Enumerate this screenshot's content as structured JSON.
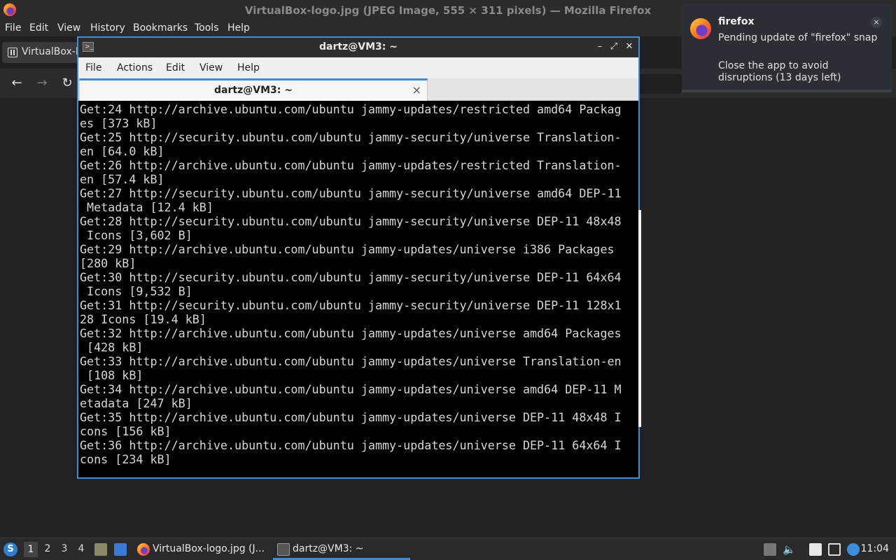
{
  "firefox": {
    "window_title": "VirtualBox-logo.jpg (JPEG Image, 555 × 311 pixels) — Mozilla Firefox",
    "menu": {
      "file": "File",
      "edit": "Edit",
      "view": "View",
      "history": "History",
      "bookmarks": "Bookmarks",
      "tools": "Tools",
      "help": "Help"
    },
    "tab_label": "VirtualBox-logo.jpg (JPEG Image, 555 × 311 pixels)",
    "nav": {
      "back": "←",
      "forward": "→",
      "reload": "↻"
    }
  },
  "notification": {
    "app": "firefox",
    "line1": "Pending update of \"firefox\" snap",
    "line2": "Close the app to avoid disruptions (13 days left)",
    "close": "×"
  },
  "terminal": {
    "title": "dartz@VM3: ~",
    "menu": {
      "file": "File",
      "actions": "Actions",
      "edit": "Edit",
      "view": "View",
      "help": "Help"
    },
    "tab_label": "dartz@VM3: ~",
    "tab_close": "×",
    "lines": [
      "Get:24 http://archive.ubuntu.com/ubuntu jammy-updates/restricted amd64 Packag",
      "es [373 kB]",
      "Get:25 http://security.ubuntu.com/ubuntu jammy-security/universe Translation-",
      "en [64.0 kB]",
      "Get:26 http://archive.ubuntu.com/ubuntu jammy-updates/restricted Translation-",
      "en [57.4 kB]",
      "Get:27 http://security.ubuntu.com/ubuntu jammy-security/universe amd64 DEP-11",
      " Metadata [12.4 kB]",
      "Get:28 http://security.ubuntu.com/ubuntu jammy-security/universe DEP-11 48x48",
      " Icons [3,602 B]",
      "Get:29 http://archive.ubuntu.com/ubuntu jammy-updates/universe i386 Packages",
      "[280 kB]",
      "Get:30 http://security.ubuntu.com/ubuntu jammy-security/universe DEP-11 64x64",
      " Icons [9,532 B]",
      "Get:31 http://security.ubuntu.com/ubuntu jammy-security/universe DEP-11 128x1",
      "28 Icons [19.4 kB]",
      "Get:32 http://archive.ubuntu.com/ubuntu jammy-updates/universe amd64 Packages",
      " [428 kB]",
      "Get:33 http://archive.ubuntu.com/ubuntu jammy-updates/universe Translation-en",
      " [108 kB]",
      "Get:34 http://archive.ubuntu.com/ubuntu jammy-updates/universe amd64 DEP-11 M",
      "etadata [247 kB]",
      "Get:35 http://archive.ubuntu.com/ubuntu jammy-updates/universe DEP-11 48x48 I",
      "cons [156 kB]",
      "Get:36 http://archive.ubuntu.com/ubuntu jammy-updates/universe DEP-11 64x64 I",
      "cons [234 kB]"
    ]
  },
  "taskbar": {
    "workspaces": [
      "1",
      "2",
      "3",
      "4"
    ],
    "tasks": [
      {
        "label": "VirtualBox-logo.jpg (J...",
        "icon": "firefox-icon"
      },
      {
        "label": "dartz@VM3: ~",
        "icon": "terminal-icon"
      }
    ],
    "clock": "11:04"
  },
  "colors": {
    "accent": "#3c8de0",
    "terminal_bg": "#000000",
    "terminal_fg": "#d6d6d6"
  }
}
